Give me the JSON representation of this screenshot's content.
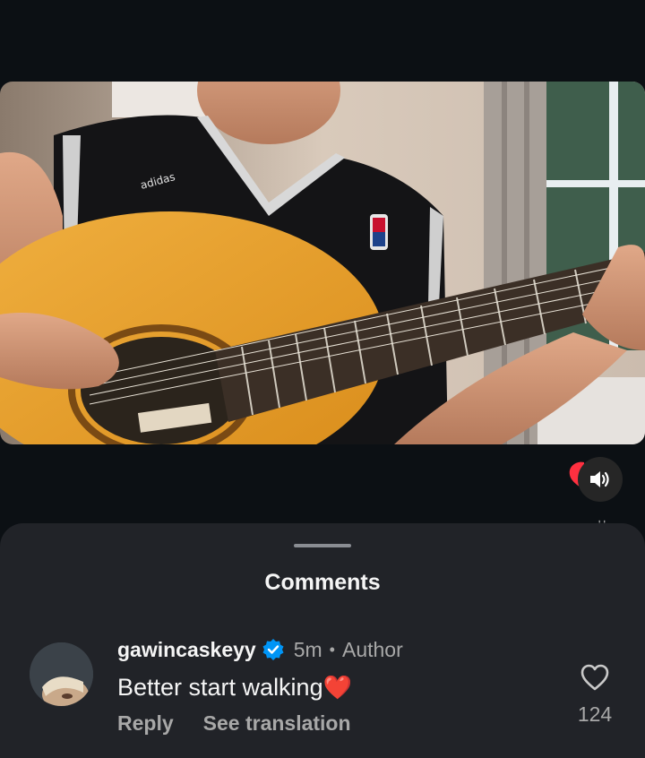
{
  "video": {
    "description_icons": {
      "heart": "heart-filled-icon",
      "mute": "speaker-icon"
    }
  },
  "comments_sheet": {
    "title": "Comments"
  },
  "comment": {
    "username": "gawincaskeyy",
    "time": "5m",
    "separator": "•",
    "author_badge": "Author",
    "text": "Better start walking",
    "emoji": "❤️",
    "reply_label": "Reply",
    "translate_label": "See translation",
    "like_count": "124"
  },
  "colors": {
    "background": "#0c1014",
    "sheet": "#212328",
    "secondary_text": "#a8a8a8",
    "verified_blue": "#0095f6",
    "like_red": "#ff3040"
  }
}
